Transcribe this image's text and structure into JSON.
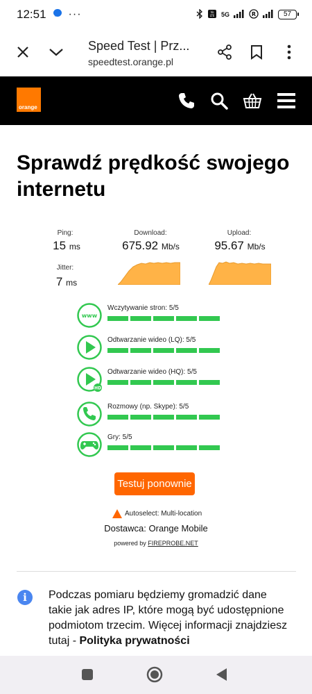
{
  "status_bar": {
    "time": "12:51",
    "network": "5G",
    "battery": "57"
  },
  "browser": {
    "page_title": "Speed Test | Prz...",
    "url": "speedtest.orange.pl"
  },
  "site": {
    "logo_text": "orange",
    "brand_color": "#ff7900"
  },
  "page": {
    "heading": "Sprawdź prędkość swojego internetu"
  },
  "results": {
    "ping_label": "Ping:",
    "ping_value": "15",
    "ping_unit": "ms",
    "jitter_label": "Jitter:",
    "jitter_value": "7",
    "jitter_unit": "ms",
    "download_label": "Download:",
    "download_value": "675.92",
    "download_unit": "Mb/s",
    "upload_label": "Upload:",
    "upload_value": "95.67",
    "upload_unit": "Mb/s"
  },
  "tests": [
    {
      "label": "Wczytywanie stron: 5/5",
      "icon": "www-icon",
      "score": 5,
      "max": 5
    },
    {
      "label": "Odtwarzanie wideo (LQ): 5/5",
      "icon": "play-icon",
      "score": 5,
      "max": 5
    },
    {
      "label": "Odtwarzanie wideo (HQ): 5/5",
      "icon": "play-hd-icon",
      "score": 5,
      "max": 5
    },
    {
      "label": "Rozmowy (np. Skype): 5/5",
      "icon": "phone-icon",
      "score": 5,
      "max": 5
    },
    {
      "label": "Gry: 5/5",
      "icon": "gamepad-icon",
      "score": 5,
      "max": 5
    }
  ],
  "actions": {
    "retest_label": "Testuj ponownie",
    "autoselect_label": "Autoselect: Multi-location",
    "provider_label": "Dostawca: Orange Mobile",
    "powered_by_prefix": "powered by ",
    "powered_by_link": "FIREPROBE.NET"
  },
  "notice": {
    "text": "Podczas pomiaru będziemy gromadzić dane takie jak adres IP, które mogą być udostępnione podmiotom trzecim. Więcej informacji znajdziesz tutaj - ",
    "link": "Polityka prywatności"
  },
  "colors": {
    "success": "#32c850",
    "accent": "#ff6600",
    "graph_fill": "#ffb347"
  }
}
